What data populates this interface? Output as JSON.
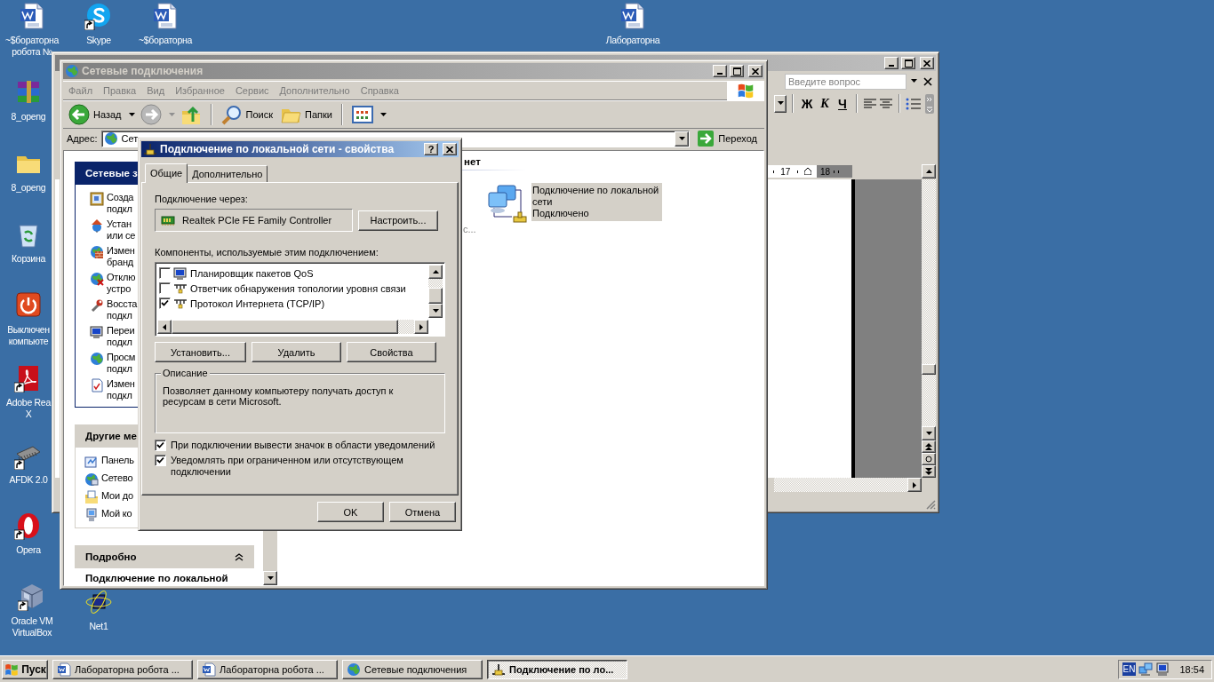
{
  "desktop_icons": [
    {
      "kind": "word",
      "label": "~$бораторна\nробота №",
      "shortcut": false
    },
    {
      "kind": "skype",
      "label": "Skype",
      "shortcut": true
    },
    {
      "kind": "word",
      "label": "~$бораторна",
      "shortcut": false
    },
    {
      "kind": "word",
      "label": "Лабораторна",
      "shortcut": false
    },
    {
      "kind": "archive",
      "label": "8_openg",
      "shortcut": false
    },
    {
      "kind": "folder",
      "label": "8_openg",
      "shortcut": false
    },
    {
      "kind": "recycle",
      "label": "Корзина",
      "shortcut": false
    },
    {
      "kind": "power",
      "label": "Выключен\nкомпьюте",
      "shortcut": false
    },
    {
      "kind": "pdf",
      "label": "Adobe Rea\nX",
      "shortcut": true
    },
    {
      "kind": "chip",
      "label": "AFDK 2.0",
      "shortcut": true
    },
    {
      "kind": "opera",
      "label": "Opera",
      "shortcut": true
    },
    {
      "kind": "cube",
      "label": "Oracle VM\nVirtualBox",
      "shortcut": true
    },
    {
      "kind": "atom",
      "label": "Net1",
      "shortcut": false
    }
  ],
  "word_window": {
    "help_placeholder": "Введите вопрос",
    "format_buttons": [
      {
        "kind": "bold",
        "label": "Ж"
      },
      {
        "kind": "italic",
        "label": "К"
      },
      {
        "kind": "underline",
        "label": "Ч"
      }
    ],
    "ruler": [
      "17",
      "18"
    ]
  },
  "explorer": {
    "title": "Сетевые подключения",
    "menu": [
      "Файл",
      "Правка",
      "Вид",
      "Избранное",
      "Сервис",
      "Дополнительно",
      "Справка"
    ],
    "toolbar": [
      {
        "kind": "back",
        "label": "Назад"
      },
      {
        "kind": "forward"
      },
      {
        "kind": "up"
      },
      {
        "kind": "search",
        "label": "Поиск"
      },
      {
        "kind": "folders",
        "label": "Папки"
      },
      {
        "kind": "views"
      }
    ],
    "address": {
      "label": "Адрес:",
      "value": "Сет",
      "go": "Переход"
    },
    "task_panels": [
      {
        "kind": "primary",
        "title": "Сетевые з",
        "items": [
          {
            "kind": "frame",
            "label": "Созда\nподкл"
          },
          {
            "kind": "house",
            "label": "Устан\nили се"
          },
          {
            "kind": "brick",
            "label": "Измен\nбранд"
          },
          {
            "kind": "globex",
            "label": "Отклю\nустро"
          },
          {
            "kind": "wrench",
            "label": "Восста\nподкл"
          },
          {
            "kind": "monitor",
            "label": "Переи\nподкл"
          },
          {
            "kind": "globe",
            "label": "Просм\nподкл"
          },
          {
            "kind": "doccheck",
            "label": "Измен\nподкл"
          }
        ]
      },
      {
        "kind": "secondary",
        "title": "Другие ме",
        "items": [
          {
            "kind": "panel",
            "label": "Панель"
          },
          {
            "kind": "places",
            "label": "Сетево"
          },
          {
            "kind": "documents",
            "label": "Мои до"
          },
          {
            "kind": "computer",
            "label": "Мой ко"
          }
        ]
      }
    ],
    "details_panel": {
      "title": "Подробно",
      "expanded": true,
      "name": "Подключение по локальной"
    },
    "content": {
      "group_header": "нет",
      "fragment": "с...",
      "connections": [
        {
          "name": "Подключение по локальной\nсети",
          "status": "Подключено",
          "selected": true
        }
      ]
    }
  },
  "dialog": {
    "title": "Подключение по локальной сети - свойства",
    "help_button": "?",
    "tabs": [
      {
        "label": "Общие",
        "selected": true
      },
      {
        "label": "Дополнительно",
        "selected": false
      }
    ],
    "connect_via_label": "Подключение через:",
    "adapter": "Realtek PCIe FE Family Controller",
    "configure_button": "Настроить...",
    "components_label": "Компоненты, используемые этим подключением:",
    "components": [
      {
        "kind": "monitor",
        "label": "Планировщик пакетов QoS",
        "checked": false
      },
      {
        "kind": "protocol",
        "label": "Ответчик обнаружения топологии уровня связи",
        "checked": false
      },
      {
        "kind": "protocol",
        "label": "Протокол Интернета (TCP/IP)",
        "checked": true
      }
    ],
    "component_buttons": [
      "Установить...",
      "Удалить",
      "Свойства"
    ],
    "description": {
      "title": "Описание",
      "text": "Позволяет данному компьютеру получать доступ к ресурсам в сети Microsoft."
    },
    "options": [
      {
        "label": "При подключении вывести значок в области уведомлений",
        "checked": true
      },
      {
        "label": "Уведомлять при ограниченном или отсутствующем подключении",
        "checked": true
      }
    ],
    "buttons": [
      "OK",
      "Отмена"
    ]
  },
  "taskbar": {
    "start": "Пуск",
    "tasks": [
      {
        "kind": "word",
        "label": "Лабораторна робота ...",
        "selected": false
      },
      {
        "kind": "word",
        "label": "Лабораторна робота ...",
        "selected": false
      },
      {
        "kind": "network",
        "label": "Сетевые подключения",
        "selected": false
      },
      {
        "kind": "connection",
        "label": "Подключение по ло...",
        "selected": true
      }
    ],
    "language": "EN",
    "time": "18:54"
  }
}
